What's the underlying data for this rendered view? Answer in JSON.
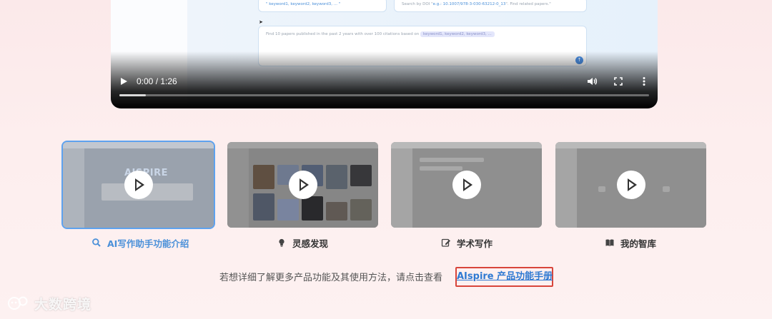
{
  "video": {
    "time": "0:00 / 1:26",
    "progress": 0.0,
    "buffered": 0.05,
    "card1_text": "\" keyword1, keyword2, keyword3, ... \"",
    "card2_prefix": "Search by DOI \"",
    "card2_doi": "e.g.: 10.1007/978-3-030-63212-0_13",
    "card2_suffix": "\". Find related papers.\"",
    "card3_text": "Find 10 papers published in the past 2 years with over 100 citations based on",
    "card3_tag": "keyword1, keyword2, keyword3, ..."
  },
  "thumbnails": [
    {
      "label": "AI写作助手功能介绍",
      "icon": "search-icon",
      "active": true,
      "mini_logo": "AISPIRE"
    },
    {
      "label": "灵感发现",
      "icon": "bulb-icon",
      "active": false
    },
    {
      "label": "学术写作",
      "icon": "pencil-icon",
      "active": false
    },
    {
      "label": "我的智库",
      "icon": "book-icon",
      "active": false
    }
  ],
  "footer": {
    "note": "若想详细了解更多产品功能及其使用方法，请点击查看",
    "manual_link": "AIspire 产品功能手册"
  },
  "watermark": "大数跨境",
  "colors": {
    "accent": "#4a90d9",
    "highlight_box": "#d8453b",
    "link": "#2f79d2"
  }
}
